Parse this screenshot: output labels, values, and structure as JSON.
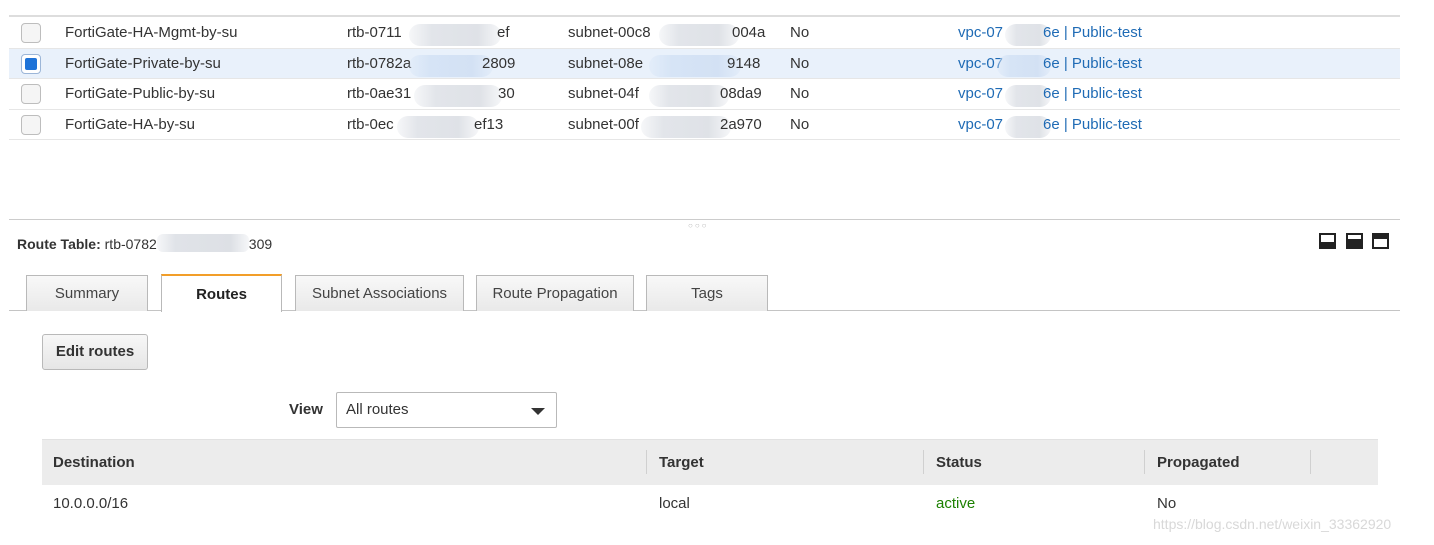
{
  "route_tables": [
    {
      "name": "FortiGate-HA-Mgmt-by-su",
      "rtb_prefix": "rtb-0711",
      "rtb_suffix": "ef",
      "subnet_prefix": "subnet-00c8",
      "subnet_suffix": "004a",
      "main": "No",
      "vpc_prefix": "vpc-07",
      "vpc_suffix": "6e | Public-test",
      "selected": false
    },
    {
      "name": "FortiGate-Private-by-su",
      "rtb_prefix": "rtb-0782a",
      "rtb_suffix": "2809",
      "subnet_prefix": "subnet-08e",
      "subnet_suffix": "9148",
      "main": "No",
      "vpc_prefix": "vpc-07",
      "vpc_suffix": "6e | Public-test",
      "selected": true
    },
    {
      "name": "FortiGate-Public-by-su",
      "rtb_prefix": "rtb-0ae31",
      "rtb_suffix": "30",
      "subnet_prefix": "subnet-04f",
      "subnet_suffix": "08da9",
      "main": "No",
      "vpc_prefix": "vpc-07",
      "vpc_suffix": "6e | Public-test",
      "selected": false
    },
    {
      "name": "FortiGate-HA-by-su",
      "rtb_prefix": "rtb-0ec",
      "rtb_suffix": "ef13",
      "subnet_prefix": "subnet-00f",
      "subnet_suffix": "2a970",
      "main": "No",
      "vpc_prefix": "vpc-07",
      "vpc_suffix": "6e | Public-test",
      "selected": false
    }
  ],
  "detail": {
    "title_label": "Route Table:",
    "title_prefix": "rtb-0782",
    "title_suffix": "309"
  },
  "layout_icons": [
    "panel-bottom-icon",
    "panel-half-icon",
    "panel-full-icon"
  ],
  "tabs": [
    {
      "label": "Summary",
      "active": false
    },
    {
      "label": "Routes",
      "active": true
    },
    {
      "label": "Subnet Associations",
      "active": false
    },
    {
      "label": "Route Propagation",
      "active": false
    },
    {
      "label": "Tags",
      "active": false
    }
  ],
  "routes_panel": {
    "edit_button": "Edit routes",
    "view_label": "View",
    "view_value": "All routes",
    "columns": [
      "Destination",
      "Target",
      "Status",
      "Propagated"
    ],
    "rows": [
      {
        "destination": "10.0.0.0/16",
        "target": "local",
        "status": "active",
        "propagated": "No"
      }
    ]
  },
  "colors": {
    "link": "#1f6bb5",
    "active_tab_accent": "#f29e29",
    "status_active": "#1d8102",
    "selected_row": "#e9f1fb"
  },
  "watermark": "https://blog.csdn.net/weixin_33362920"
}
